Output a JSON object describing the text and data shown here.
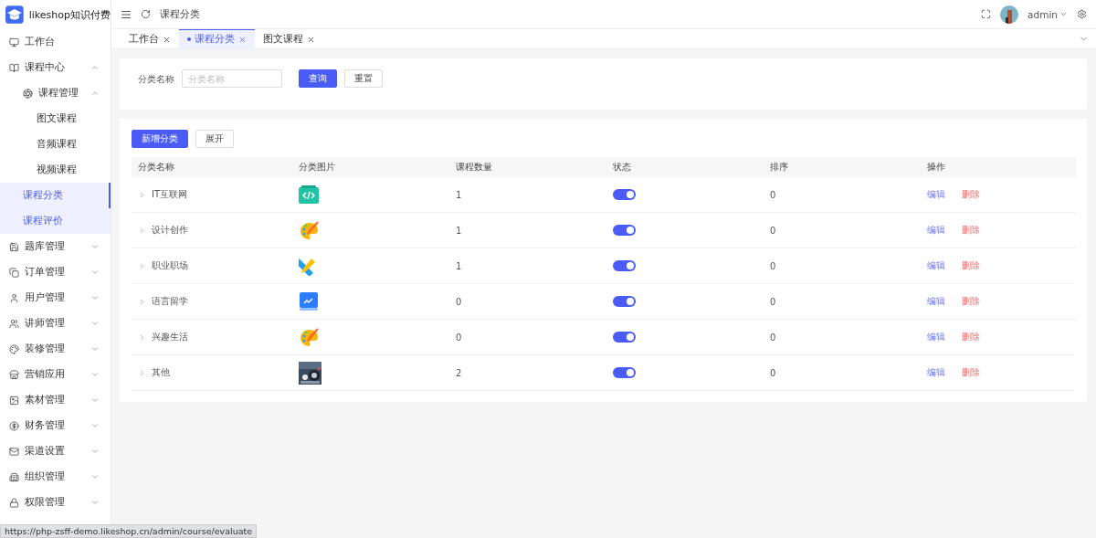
{
  "app": {
    "title": "likeshop知识付费"
  },
  "breadcrumb": "课程分类",
  "user": {
    "name": "admin"
  },
  "tabs": [
    {
      "label": "工作台",
      "selected": false
    },
    {
      "label": "课程分类",
      "selected": true
    },
    {
      "label": "图文课程",
      "selected": false
    }
  ],
  "sidebar": {
    "items": [
      {
        "label": "工作台",
        "selected": false,
        "highlighted": false
      },
      {
        "label": "课程中心",
        "expanded": true,
        "selected": false,
        "highlighted": false,
        "children": [
          {
            "label": "课程管理",
            "expanded": true,
            "selected": false,
            "highlighted": false,
            "children": [
              {
                "label": "图文课程",
                "selected": false,
                "highlighted": false
              },
              {
                "label": "音频课程",
                "selected": false,
                "highlighted": false
              },
              {
                "label": "视频课程",
                "selected": false,
                "highlighted": false
              }
            ]
          },
          {
            "label": "课程分类",
            "selected": true,
            "highlighted": true
          },
          {
            "label": "课程评价",
            "selected": false,
            "highlighted": true
          }
        ]
      },
      {
        "label": "题库管理",
        "expanded": false,
        "selected": false,
        "highlighted": false
      },
      {
        "label": "订单管理",
        "expanded": false,
        "selected": false,
        "highlighted": false
      },
      {
        "label": "用户管理",
        "expanded": false,
        "selected": false,
        "highlighted": false
      },
      {
        "label": "讲师管理",
        "expanded": false,
        "selected": false,
        "highlighted": false
      },
      {
        "label": "装修管理",
        "expanded": false,
        "selected": false,
        "highlighted": false
      },
      {
        "label": "营销应用",
        "expanded": false,
        "selected": false,
        "highlighted": false
      },
      {
        "label": "素材管理",
        "expanded": false,
        "selected": false,
        "highlighted": false
      },
      {
        "label": "财务管理",
        "expanded": false,
        "selected": false,
        "highlighted": false
      },
      {
        "label": "渠道设置",
        "expanded": false,
        "selected": false,
        "highlighted": false
      },
      {
        "label": "组织管理",
        "expanded": false,
        "selected": false,
        "highlighted": false
      },
      {
        "label": "权限管理",
        "expanded": false,
        "selected": false,
        "highlighted": false
      }
    ]
  },
  "search": {
    "label": "分类名称",
    "placeholder": "分类名称",
    "buttons": [
      {
        "label": "查询",
        "kind": "primary"
      },
      {
        "label": "重置",
        "kind": "plain"
      }
    ]
  },
  "toolbar": [
    {
      "label": "新增分类",
      "kind": "primary"
    },
    {
      "label": "展开",
      "kind": "plain"
    }
  ],
  "table": {
    "columns": [
      "分类名称",
      "分类图片",
      "课程数量",
      "状态",
      "排序",
      "操作"
    ],
    "rows": [
      {
        "name": "IT互联网",
        "count": "1",
        "on": true,
        "sort": "0",
        "actions": [
          "编辑",
          "删除"
        ]
      },
      {
        "name": "设计创作",
        "count": "1",
        "on": true,
        "sort": "0",
        "actions": [
          "编辑",
          "删除"
        ]
      },
      {
        "name": "职业职场",
        "count": "1",
        "on": true,
        "sort": "0",
        "actions": [
          "编辑",
          "删除"
        ]
      },
      {
        "name": "语言留学",
        "count": "0",
        "on": true,
        "sort": "0",
        "actions": [
          "编辑",
          "删除"
        ]
      },
      {
        "name": "兴趣生活",
        "count": "0",
        "on": true,
        "sort": "0",
        "actions": [
          "编辑",
          "删除"
        ]
      },
      {
        "name": "其他",
        "count": "2",
        "on": true,
        "sort": "0",
        "actions": [
          "编辑",
          "删除"
        ]
      }
    ]
  },
  "status_url": "https://php-zsff-demo.likeshop.cn/admin/course/evaluate"
}
